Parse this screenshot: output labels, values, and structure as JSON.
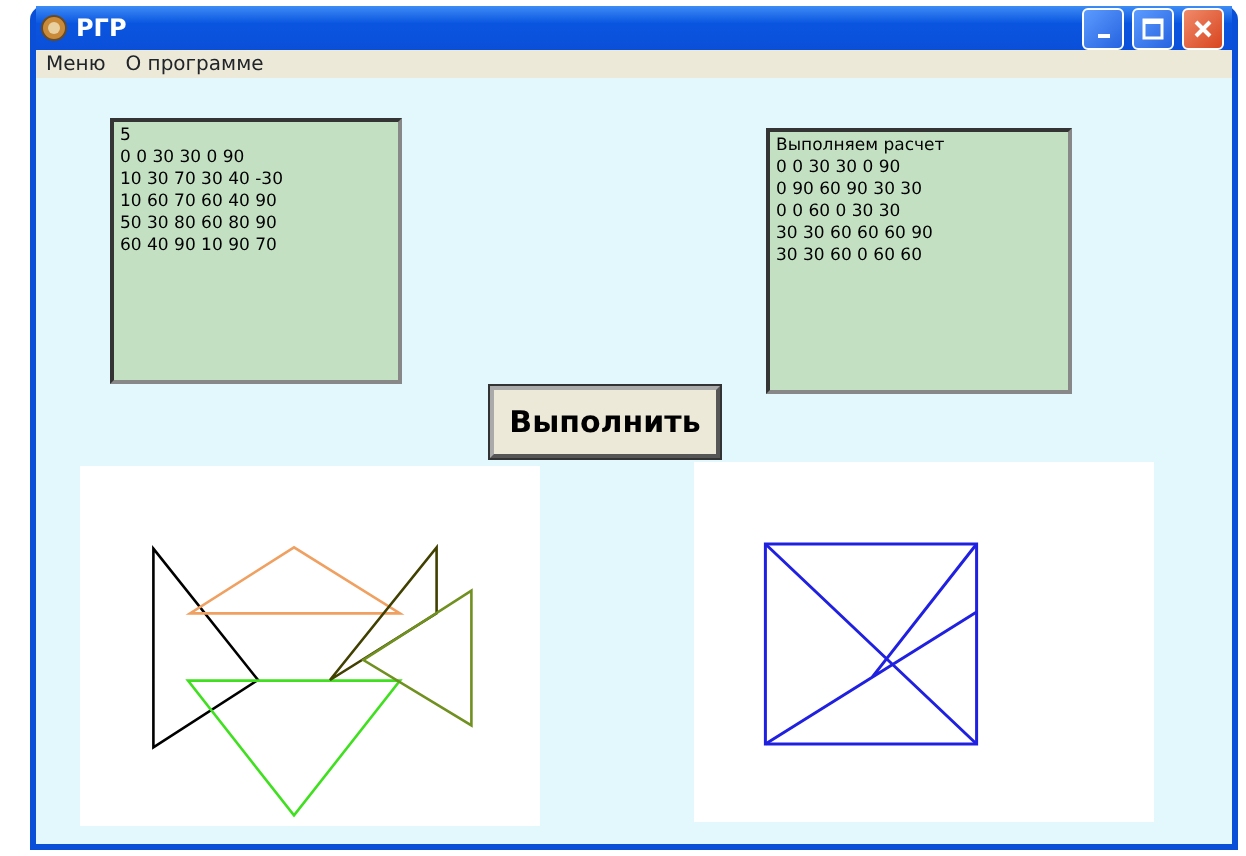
{
  "window": {
    "title": "РГР"
  },
  "menu": [
    {
      "label": "Меню"
    },
    {
      "label": "О программе"
    }
  ],
  "input_box": {
    "lines": [
      "5",
      "0 0 30 30 0 90",
      "10 30 70 30 40 -30",
      "10 60 70 60 40 90",
      "50 30 80 60 80 90",
      "60 40 90 10 90 70"
    ]
  },
  "output_box": {
    "lines": [
      "Выполняем расчет",
      "0 0 30 30 0 90",
      "0 90 60 90 30 30",
      "0 0 60 0 30 30",
      "30 30 60 60 60 90",
      "30 30 60 0 60 60"
    ]
  },
  "run_button": {
    "label": "Выполнить"
  }
}
